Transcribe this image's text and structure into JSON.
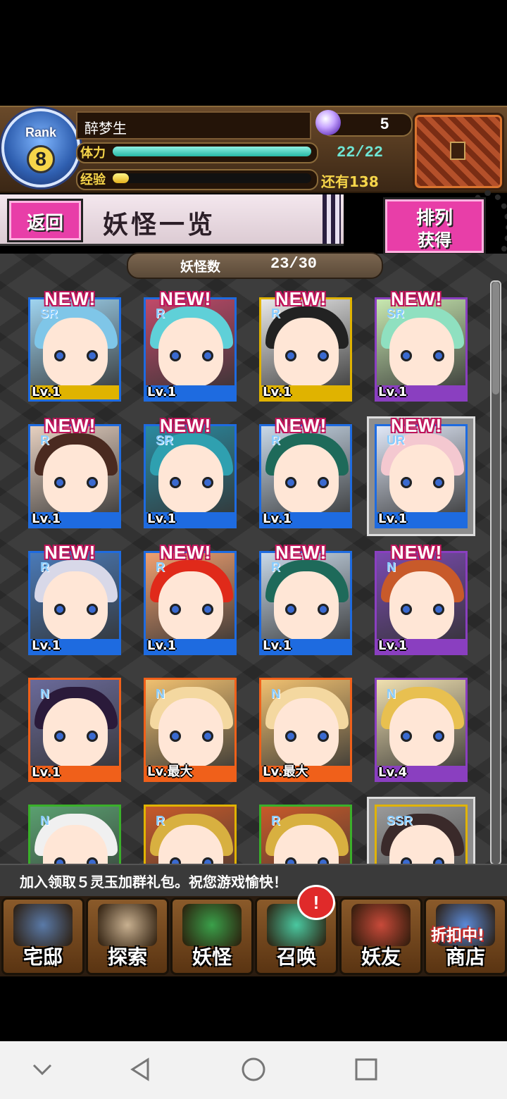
{
  "player": {
    "rank_label": "Rank",
    "rank": "8",
    "name": "醉梦生",
    "stamina_label": "体力",
    "stamina_value": "22/22",
    "stamina_fraction": 1.0,
    "exp_label": "经验",
    "exp_remaining": "还有138",
    "exp_fraction": 0.08,
    "gems": "5"
  },
  "header": {
    "back_label": "返回",
    "title": "妖怪一览",
    "sort_line1": "排列",
    "sort_line2": "获得"
  },
  "count": {
    "label": "妖怪数",
    "value": "23/30"
  },
  "cards": [
    {
      "rarity": "SR",
      "level": "Lv.1",
      "new": "NEW!",
      "border": "#1e6be0",
      "hair": "#7fc6e8",
      "bg": "#9fd4f0",
      "strip": "#e0b300",
      "selected": false
    },
    {
      "rarity": "R",
      "level": "Lv.1",
      "new": "NEW!",
      "border": "#1e6be0",
      "hair": "#5fd0d8",
      "bg": "#c04a6a",
      "strip": "#1e6be0",
      "selected": false
    },
    {
      "rarity": "R",
      "level": "Lv.1",
      "new": "NEW!",
      "border": "#e0b300",
      "hair": "#222222",
      "bg": "#e8e8e8",
      "strip": "#e0b300",
      "selected": false
    },
    {
      "rarity": "SR",
      "level": "Lv.1",
      "new": "NEW!",
      "border": "#8a3fc0",
      "hair": "#8fe0c0",
      "bg": "#c8e8b0",
      "strip": "#8a3fc0",
      "selected": false
    },
    {
      "rarity": "R",
      "level": "Lv.1",
      "new": "NEW!",
      "border": "#1e6be0",
      "hair": "#4a2a20",
      "bg": "#e6d0c0",
      "strip": "#1e6be0",
      "selected": false
    },
    {
      "rarity": "SR",
      "level": "Lv.1",
      "new": "NEW!",
      "border": "#1e6be0",
      "hair": "#2fa0b0",
      "bg": "#2a8aa0",
      "strip": "#1e6be0",
      "selected": false
    },
    {
      "rarity": "R",
      "level": "Lv.1",
      "new": "NEW!",
      "border": "#1e6be0",
      "hair": "#1e6a5a",
      "bg": "#c8d8e8",
      "strip": "#1e6be0",
      "selected": false
    },
    {
      "rarity": "UR",
      "level": "Lv.1",
      "new": "NEW!",
      "border": "#1e6be0",
      "hair": "#f4c8d0",
      "bg": "#e0e8f8",
      "strip": "#1e6be0",
      "selected": true
    },
    {
      "rarity": "R",
      "level": "Lv.1",
      "new": "NEW!",
      "border": "#1e6be0",
      "hair": "#d8d8e8",
      "bg": "#4a7ab8",
      "strip": "#1e6be0",
      "selected": false
    },
    {
      "rarity": "R",
      "level": "Lv.1",
      "new": "NEW!",
      "border": "#1e6be0",
      "hair": "#e02a1a",
      "bg": "#f0a070",
      "strip": "#1e6be0",
      "selected": false
    },
    {
      "rarity": "R",
      "level": "Lv.1",
      "new": "NEW!",
      "border": "#1e6be0",
      "hair": "#1e6a5a",
      "bg": "#c8d8e8",
      "strip": "#1e6be0",
      "selected": false
    },
    {
      "rarity": "N",
      "level": "Lv.1",
      "new": "NEW!",
      "border": "#8a3fc0",
      "hair": "#c85a2a",
      "bg": "#7a4ab0",
      "strip": "#8a3fc0",
      "selected": false
    },
    {
      "rarity": "N",
      "level": "Lv.1",
      "new": "",
      "border": "#f0601a",
      "hair": "#2a1a3a",
      "bg": "#6a6a9a",
      "strip": "#f0601a",
      "selected": false
    },
    {
      "rarity": "N",
      "level": "Lv.最大",
      "new": "",
      "border": "#f0601a",
      "hair": "#f4d8a0",
      "bg": "#f0c070",
      "strip": "#f0601a",
      "selected": false
    },
    {
      "rarity": "N",
      "level": "Lv.最大",
      "new": "",
      "border": "#f0601a",
      "hair": "#f4d8a0",
      "bg": "#f0c070",
      "strip": "#f0601a",
      "selected": false
    },
    {
      "rarity": "N",
      "level": "Lv.4",
      "new": "",
      "border": "#8a3fc0",
      "hair": "#e8c050",
      "bg": "#f0e0b0",
      "strip": "#8a3fc0",
      "selected": false
    },
    {
      "rarity": "N",
      "level": "",
      "new": "",
      "border": "#3ab02a",
      "hair": "#f0f0f0",
      "bg": "#5aa070",
      "strip": "#3ab02a",
      "selected": false
    },
    {
      "rarity": "R",
      "level": "",
      "new": "",
      "border": "#e0b300",
      "hair": "#d8b040",
      "bg": "#c85a2a",
      "strip": "#e0b300",
      "selected": false
    },
    {
      "rarity": "R",
      "level": "",
      "new": "",
      "border": "#3ab02a",
      "hair": "#d8b040",
      "bg": "#c85a2a",
      "strip": "#3ab02a",
      "selected": false
    },
    {
      "rarity": "SSR",
      "level": "",
      "new": "",
      "border": "#e0b300",
      "hair": "#3a2a2a",
      "bg": "#9a9a9a",
      "strip": "#e0b300",
      "selected": true
    }
  ],
  "marquee": "加入领取５灵玉加群礼包。祝您游戏愉快！",
  "nav": [
    {
      "label": "宅邸",
      "icon": "mansion-icon",
      "color": "#5a7aa8"
    },
    {
      "label": "探索",
      "icon": "magnifier-icon",
      "color": "#c8b090"
    },
    {
      "label": "妖怪",
      "icon": "scroll-icon",
      "color": "#3aa04a"
    },
    {
      "label": "召唤",
      "icon": "pentagram-icon",
      "color": "#4ac8a0"
    },
    {
      "label": "妖友",
      "icon": "catgirl-icon",
      "color": "#c84a3a"
    },
    {
      "label": "商店",
      "icon": "crystal-orb-icon",
      "color": "#5a8ad8"
    }
  ],
  "nav_alert": "!",
  "sale_badge": "折扣中!",
  "system_nav": [
    "back-icon",
    "home-icon",
    "recents-icon",
    "collapse-icon"
  ]
}
